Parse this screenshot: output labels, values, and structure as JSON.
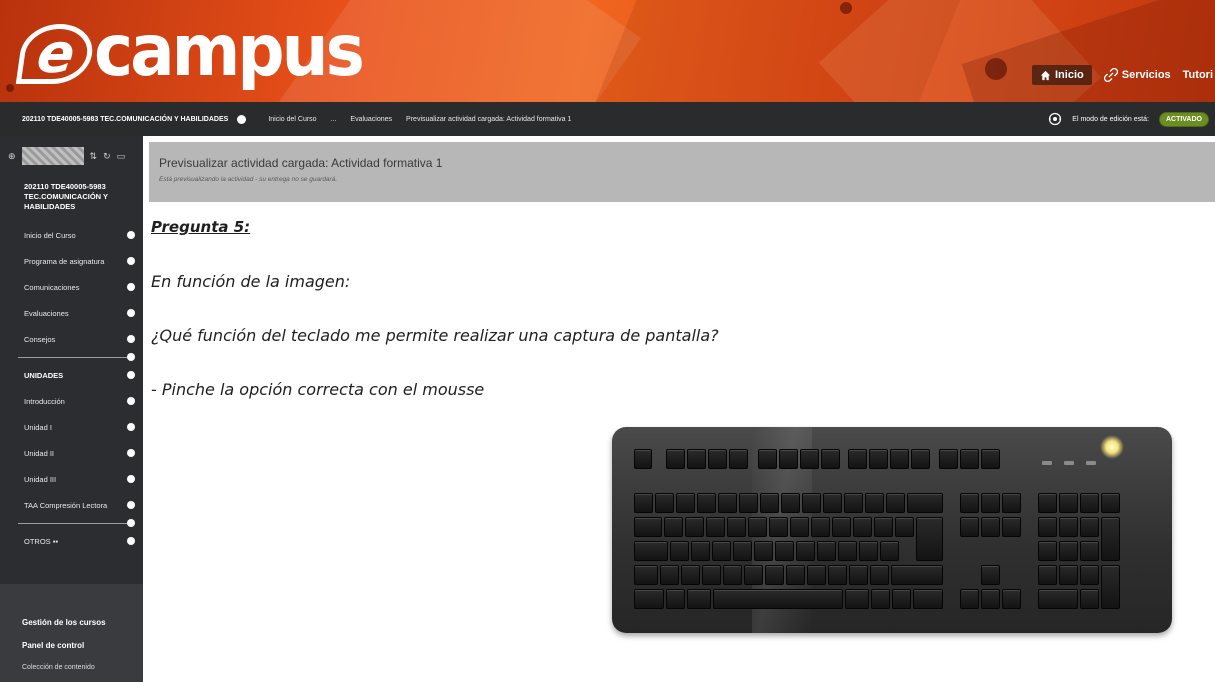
{
  "banner": {
    "logo_text": "ecampus",
    "nav": [
      {
        "label": "Inicio",
        "icon": "home-icon",
        "active": true
      },
      {
        "label": "Servicios",
        "icon": "link-icon",
        "active": false
      },
      {
        "label": "Tutori",
        "icon": "",
        "active": false
      }
    ],
    "brand_color": "#e8501a"
  },
  "coursebar": {
    "course_title": "202110 TDE40005-5983 TEC.COMUNICACIÓN Y HABILIDADES",
    "breadcrumbs": [
      "Inicio del Curso",
      "...",
      "Evaluaciones",
      "Previsualizar actividad cargada: Actividad formativa 1"
    ],
    "edit_mode_label": "El modo de edición está:",
    "edit_mode_value": "ACTIVADO"
  },
  "sidebar": {
    "course_name": "202110 TDE40005-5983 TEC.COMUNICACIÓN Y HABILIDADES",
    "items": [
      "Inicio del Curso",
      "Programa de asignatura",
      "Comunicaciones",
      "Evaluaciones",
      "Consejos"
    ],
    "units_heading": "UNIDADES",
    "units": [
      "Introducción",
      "Unidad I",
      "Unidad II",
      "Unidad III",
      "TAA Compresión Lectora"
    ],
    "others": "OTROS",
    "management_heading": "Gestión de los cursos",
    "control_panel": "Panel de control",
    "content_collection": "Colección de contenido"
  },
  "main": {
    "preview_title": "Previsualizar actividad cargada: Actividad formativa 1",
    "preview_note": "Está previsualizando la actividad - su entrega no se guardará.",
    "question_title": "Pregunta 5:",
    "line1": "En función de la imagen:",
    "line2": "¿Qué función del teclado me permite realizar una captura de pantalla?",
    "line3": "- Pinche la opción correcta con el mousse"
  }
}
